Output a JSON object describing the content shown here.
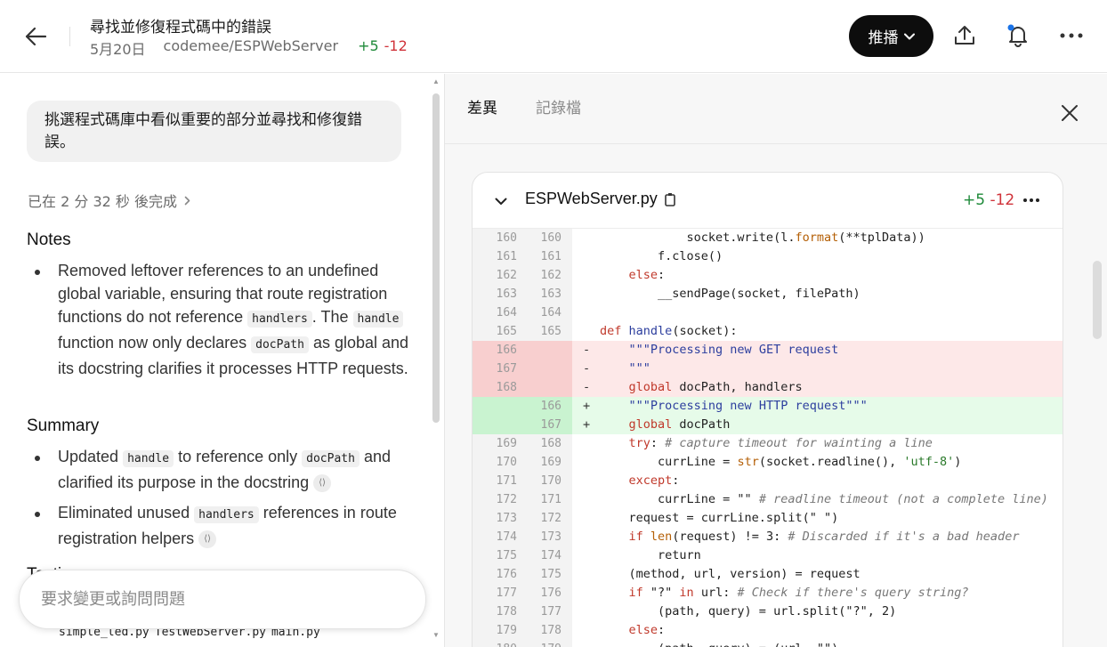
{
  "header": {
    "title": "尋找並修復程式碼中的錯誤",
    "date": "5月20日",
    "repo": "codemee/ESPWebServer",
    "additions": "+5",
    "deletions": "-12",
    "push_label": "推播"
  },
  "left": {
    "prompt": "挑選程式碼庫中看似重要的部分並尋找和修復錯誤。",
    "completed": "已在 2 分 32 秒 後完成",
    "notes_heading": "Notes",
    "notes": {
      "p1": "Removed leftover references to an undefined global variable, ensuring that route registration functions do not reference",
      "c1": "handlers",
      "p2": ". The",
      "c2": "handle",
      "p3": "function now only declares",
      "c3": "docPath",
      "p4": "as global and its docstring clarifies it processes HTTP requests."
    },
    "summary_heading": "Summary",
    "summary": [
      {
        "p1": "Updated",
        "c1": "handle",
        "p2": "to reference only",
        "c2": "docPath",
        "p3": "and clarified its purpose in the docstring"
      },
      {
        "p1": "Eliminated unused",
        "c1": "handlers",
        "p2": "references in route registration helpers"
      }
    ],
    "tests_heading": "Testing",
    "files": [
      "simple_led.py",
      "TestWebServer.py",
      "main.py"
    ],
    "composer_placeholder": "要求變更或詢問問題"
  },
  "right": {
    "tabs": [
      "差異",
      "記錄檔"
    ],
    "file": {
      "name": "ESPWebServer.py",
      "additions": "+5",
      "deletions": "-12"
    },
    "lines": [
      {
        "old": "160",
        "new": "160",
        "sign": "",
        "type": "ctx",
        "code": "            socket.write(l.format(**tplData))"
      },
      {
        "old": "161",
        "new": "161",
        "sign": "",
        "type": "ctx",
        "code": "        f.close()"
      },
      {
        "old": "162",
        "new": "162",
        "sign": "",
        "type": "ctx",
        "code": "    else:"
      },
      {
        "old": "163",
        "new": "163",
        "sign": "",
        "type": "ctx",
        "code": "        __sendPage(socket, filePath)"
      },
      {
        "old": "164",
        "new": "164",
        "sign": "",
        "type": "ctx",
        "code": ""
      },
      {
        "old": "165",
        "new": "165",
        "sign": "",
        "type": "ctx",
        "code": "def handle(socket):"
      },
      {
        "old": "166",
        "new": "",
        "sign": "-",
        "type": "del",
        "code": "    \"\"\"Processing new GET request"
      },
      {
        "old": "167",
        "new": "",
        "sign": "-",
        "type": "del",
        "code": "    \"\"\""
      },
      {
        "old": "168",
        "new": "",
        "sign": "-",
        "type": "del",
        "code": "    global docPath, handlers"
      },
      {
        "old": "",
        "new": "166",
        "sign": "+",
        "type": "add",
        "code": "    \"\"\"Processing new HTTP request\"\"\""
      },
      {
        "old": "",
        "new": "167",
        "sign": "+",
        "type": "add",
        "code": "    global docPath"
      },
      {
        "old": "169",
        "new": "168",
        "sign": "",
        "type": "ctx",
        "code": "    try: # capture timeout for wainting a line"
      },
      {
        "old": "170",
        "new": "169",
        "sign": "",
        "type": "ctx",
        "code": "        currLine = str(socket.readline(), 'utf-8')"
      },
      {
        "old": "171",
        "new": "170",
        "sign": "",
        "type": "ctx",
        "code": "    except:"
      },
      {
        "old": "172",
        "new": "171",
        "sign": "",
        "type": "ctx",
        "code": "        currLine = \"\" # readline timeout (not a complete line)"
      },
      {
        "old": "173",
        "new": "172",
        "sign": "",
        "type": "ctx",
        "code": "    request = currLine.split(\" \")"
      },
      {
        "old": "174",
        "new": "173",
        "sign": "",
        "type": "ctx",
        "code": "    if len(request) != 3: # Discarded if it's a bad header"
      },
      {
        "old": "175",
        "new": "174",
        "sign": "",
        "type": "ctx",
        "code": "        return"
      },
      {
        "old": "176",
        "new": "175",
        "sign": "",
        "type": "ctx",
        "code": "    (method, url, version) = request"
      },
      {
        "old": "177",
        "new": "176",
        "sign": "",
        "type": "ctx",
        "code": "    if \"?\" in url: # Check if there's query string?"
      },
      {
        "old": "178",
        "new": "177",
        "sign": "",
        "type": "ctx",
        "code": "        (path, query) = url.split(\"?\", 2)"
      },
      {
        "old": "179",
        "new": "178",
        "sign": "",
        "type": "ctx",
        "code": "    else:"
      },
      {
        "old": "180",
        "new": "179",
        "sign": "",
        "type": "ctx",
        "code": "        (path, query) = (url, \"\")"
      }
    ]
  },
  "colors": {
    "add": "#1f8a3a",
    "del": "#d0333a",
    "push_bg": "#0d0d0d",
    "notification_dot": "#1a73e8"
  }
}
